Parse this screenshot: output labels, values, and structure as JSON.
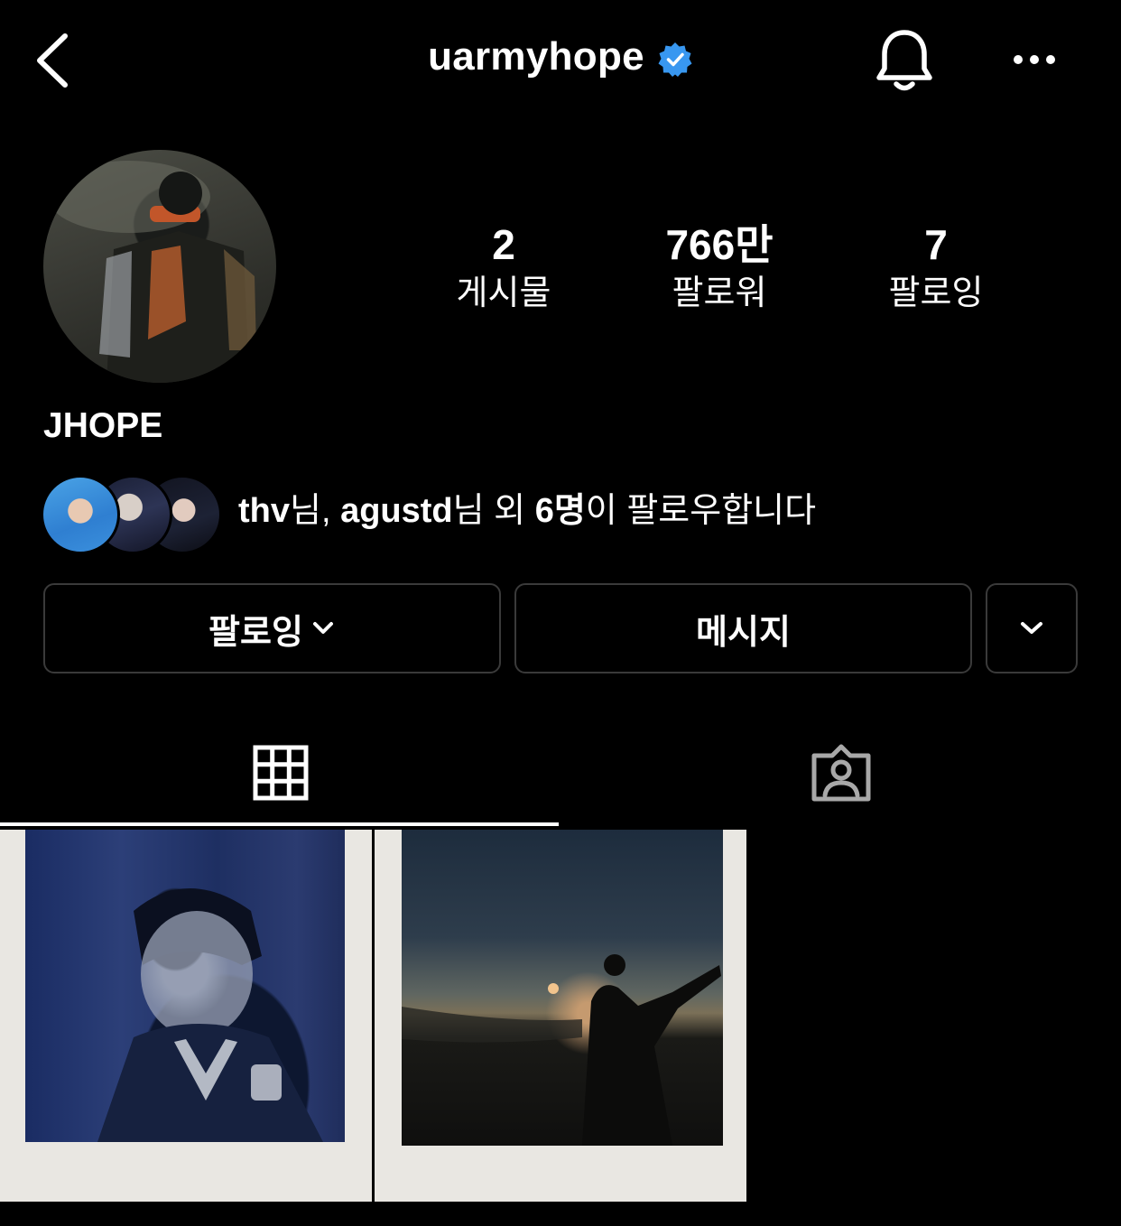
{
  "header": {
    "username": "uarmyhope",
    "icons": {
      "back": "chevron-left-icon",
      "verified": "verified-badge-icon",
      "notifications": "bell-icon",
      "more": "more-horizontal-icon"
    }
  },
  "profile": {
    "display_name": "JHOPE",
    "stats": [
      {
        "value": "2",
        "label": "게시물"
      },
      {
        "value": "766만",
        "label": "팔로워"
      },
      {
        "value": "7",
        "label": "팔로잉"
      }
    ],
    "followed_by": {
      "user1": "thv",
      "suffix1": "님, ",
      "user2": "agustd",
      "suffix2": "님 외 ",
      "count": "6명",
      "suffix3": "이 팔로우합니다"
    }
  },
  "actions": {
    "following_label": "팔로잉",
    "message_label": "메시지"
  },
  "tabs": {
    "grid_icon": "grid-icon",
    "tagged_icon": "tagged-person-icon"
  },
  "colors": {
    "background": "#000000",
    "text": "#ffffff",
    "verified": "#3897f0",
    "button_border": "#3a3a3a",
    "inactive_icon": "#a8a8a8"
  }
}
